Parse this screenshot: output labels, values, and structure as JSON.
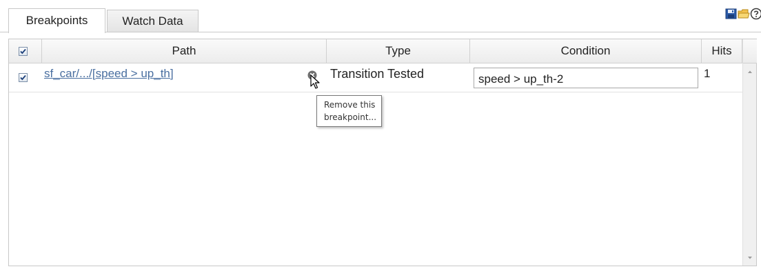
{
  "tabs": [
    {
      "label": "Breakpoints",
      "active": true
    },
    {
      "label": "Watch Data",
      "active": false
    }
  ],
  "toolbar": {
    "icons": [
      "save-icon",
      "open-folder-icon",
      "help-icon"
    ]
  },
  "table": {
    "columns": {
      "path": "Path",
      "type": "Type",
      "condition": "Condition",
      "hits": "Hits"
    },
    "header_checked": true,
    "rows": [
      {
        "checked": true,
        "path": "sf_car/.../[speed > up_th]",
        "type": "Transition Tested",
        "condition": "speed > up_th-2",
        "hits": "1"
      }
    ]
  },
  "tooltip": {
    "line1": "Remove this",
    "line2": "breakpoint..."
  },
  "colors": {
    "link": "#4a6fa0",
    "border": "#c8c8c8",
    "header_bg": "#ececec"
  }
}
